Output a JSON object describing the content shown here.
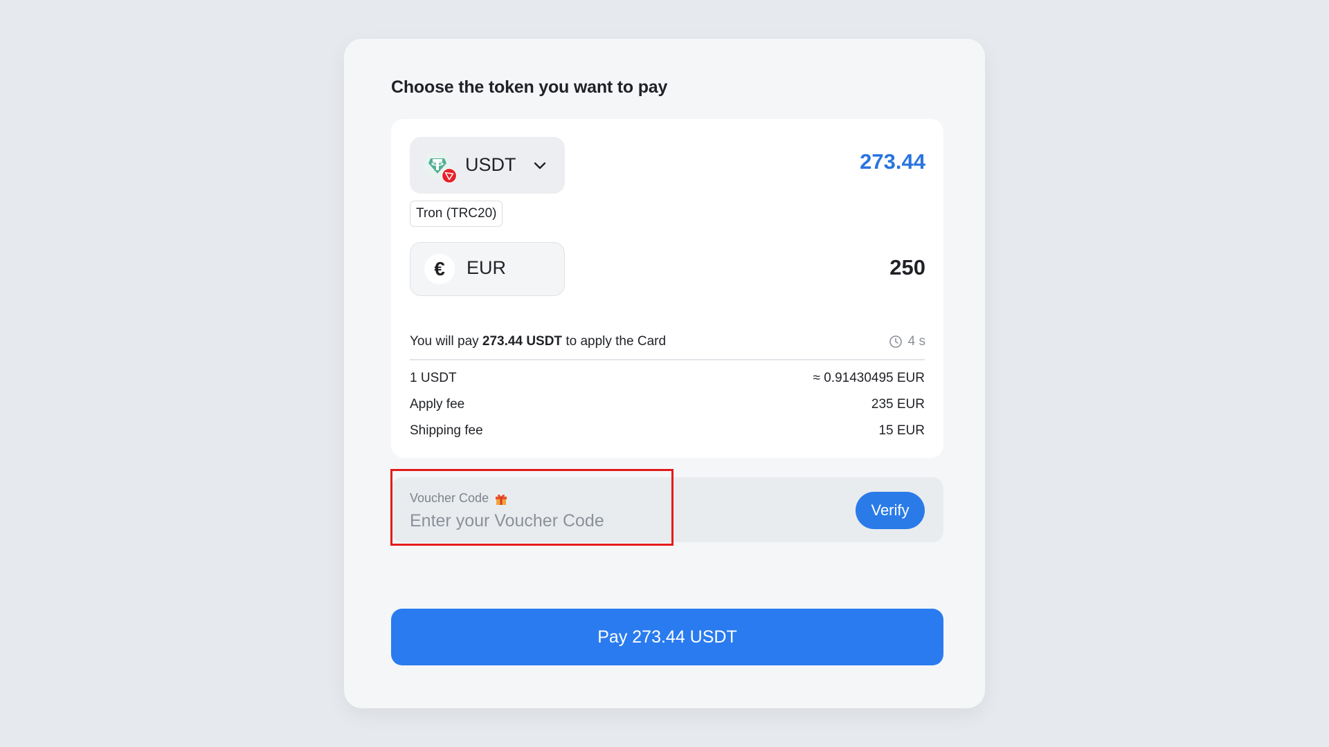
{
  "title": "Choose the token you want to pay",
  "token": {
    "symbol": "USDT",
    "network": "Tron (TRC20)",
    "amount": "273.44",
    "icon": "tether-icon",
    "network_icon": "tron-icon",
    "amount_color": "#2a74e0"
  },
  "fiat": {
    "symbol": "EUR",
    "icon_glyph": "€",
    "amount": "250"
  },
  "summary": {
    "prefix": "You will pay ",
    "amount_bold": "273.44 USDT",
    "suffix": " to apply the Card",
    "timer": "4 s"
  },
  "rows": [
    {
      "label": "1 USDT",
      "value": "≈ 0.91430495 EUR"
    },
    {
      "label": "Apply fee",
      "value": "235 EUR"
    },
    {
      "label": "Shipping fee",
      "value": "15 EUR"
    }
  ],
  "voucher": {
    "label": "Voucher Code",
    "placeholder": "Enter your Voucher Code",
    "verify_label": "Verify",
    "gift_icon": "gift-icon"
  },
  "pay_button": {
    "label": "Pay 273.44 USDT",
    "color": "#2a7bef"
  },
  "highlight_color": "#e31b1b"
}
